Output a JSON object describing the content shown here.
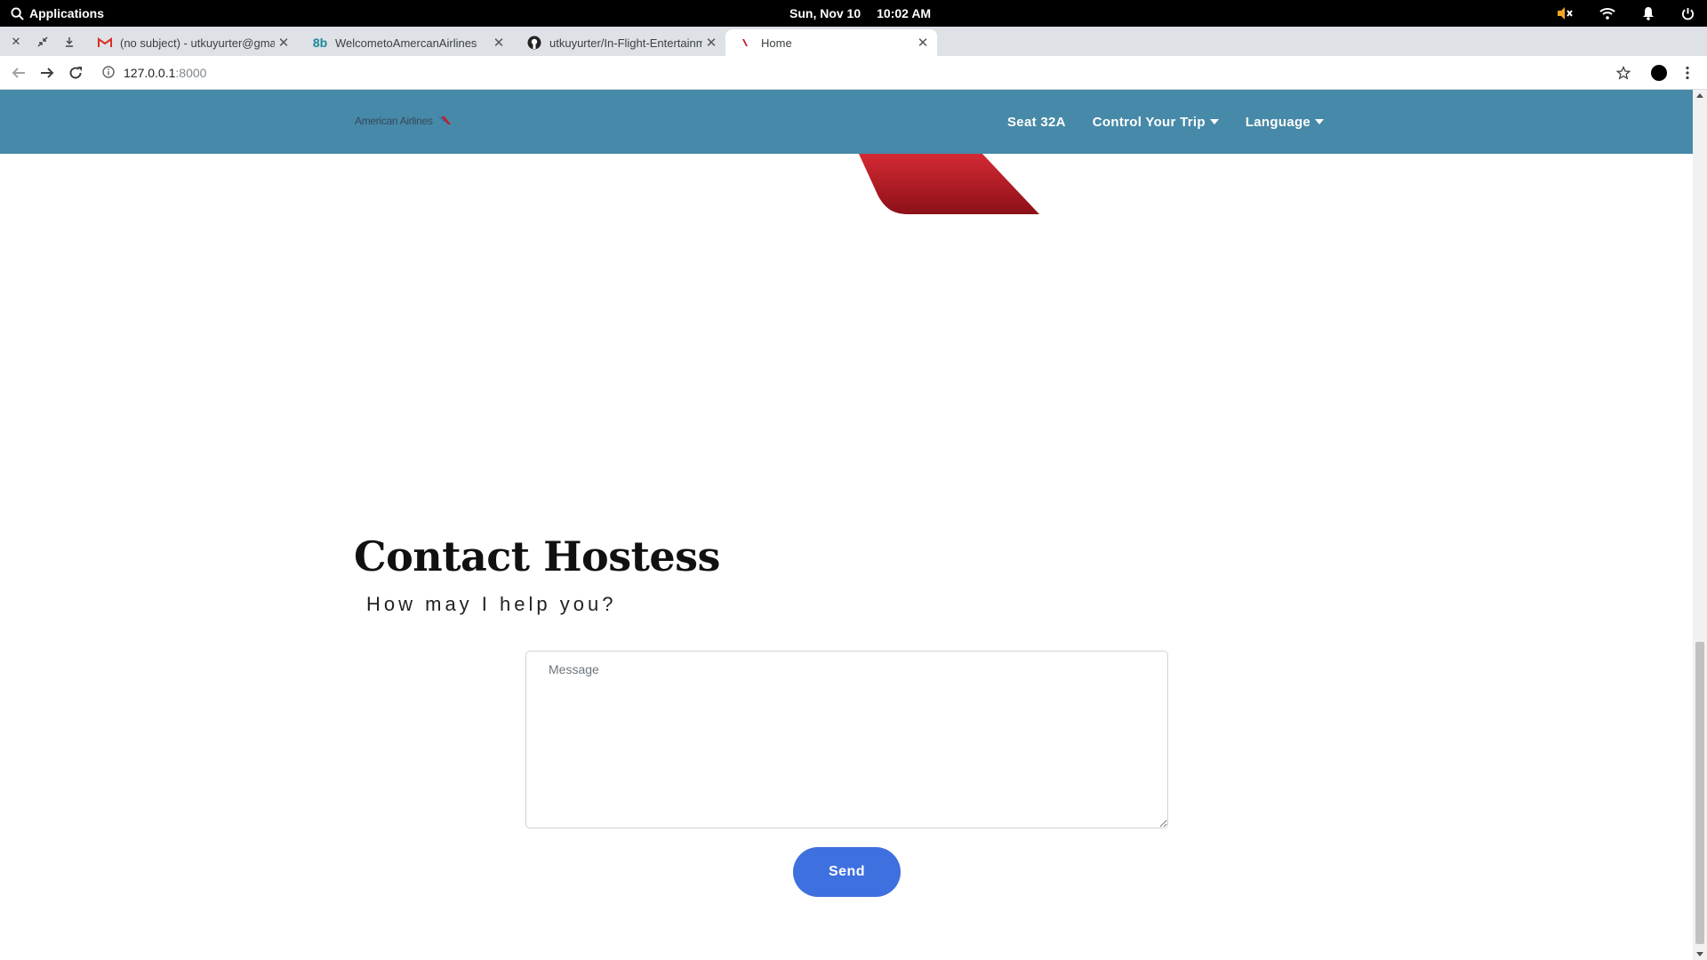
{
  "system_bar": {
    "applications_label": "Applications",
    "date": "Sun, Nov 10",
    "time": "10:02 AM",
    "tray_icons": [
      "volume-muted-icon",
      "wifi-icon",
      "bell-icon",
      "power-icon"
    ]
  },
  "browser": {
    "tabs": [
      {
        "title": "(no subject) - utkuyurter@gmail",
        "favicon": "gmail-icon",
        "active": false
      },
      {
        "title": "WelcometoAmercanAirlines",
        "favicon": "8b-icon",
        "favicon_text": "8b",
        "active": false
      },
      {
        "title": "utkuyurter/In-Flight-Entertainm",
        "favicon": "github-icon",
        "active": false
      },
      {
        "title": "Home",
        "favicon": "american-airlines-icon",
        "active": true
      }
    ],
    "address": {
      "host": "127.0.0.1",
      "port": ":8000"
    }
  },
  "site": {
    "brand": "American Airlines",
    "nav": {
      "seat": "Seat 32A",
      "control_trip": "Control Your Trip",
      "language": "Language"
    },
    "contact": {
      "title": "Contact Hostess",
      "subtitle": "How may I help you?",
      "message_placeholder": "Message",
      "message_value": "",
      "send_label": "Send"
    }
  },
  "colors": {
    "navbar": "#4789a8",
    "send_button": "#3f70e0",
    "brand_red": "#c41e2a"
  }
}
